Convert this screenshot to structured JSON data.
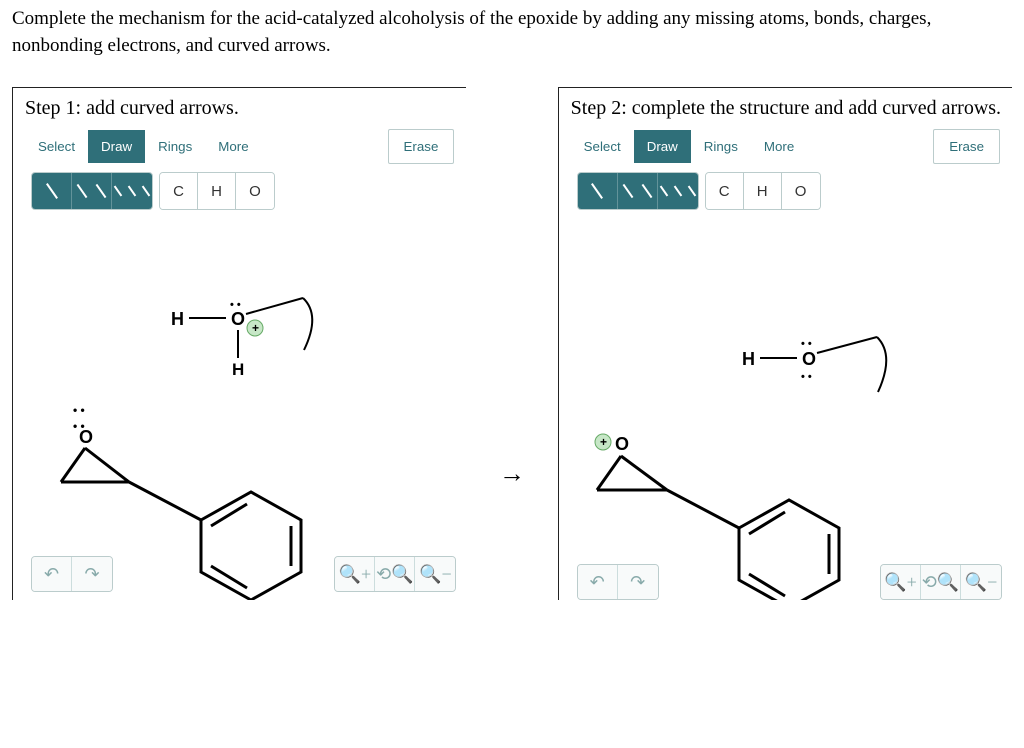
{
  "question": "Complete the mechanism for the acid-catalyzed alcoholysis of the epoxide by adding any missing atoms, bonds, charges, nonbonding electrons, and curved arrows.",
  "panels": [
    {
      "title": "Step 1: add curved arrows.",
      "tabs": {
        "select": "Select",
        "draw": "Draw",
        "rings": "Rings",
        "more": "More"
      },
      "erase": "Erase",
      "atoms": [
        "C",
        "H",
        "O"
      ],
      "molecule_smiles": "c1ccccc1C1OC1.[OH3+] (epoxide with protonated methanol nearby)",
      "step1_labels": {
        "H": "H",
        "O_top": "O",
        "plus": "+",
        "H_mid": "H",
        "O_left": "O"
      }
    },
    {
      "title": "Step 2: complete the structure and add curved arrows.",
      "tabs": {
        "select": "Select",
        "draw": "Draw",
        "rings": "Rings",
        "more": "More"
      },
      "erase": "Erase",
      "atoms": [
        "C",
        "H",
        "O"
      ],
      "molecule_smiles": "c1ccccc1C1OC1.[OH+]=? protonated epoxide + CH3OH",
      "step2_labels": {
        "H": "H",
        "O_top": "O",
        "O_left": "O",
        "plus": "+"
      }
    }
  ],
  "arrow": "→"
}
